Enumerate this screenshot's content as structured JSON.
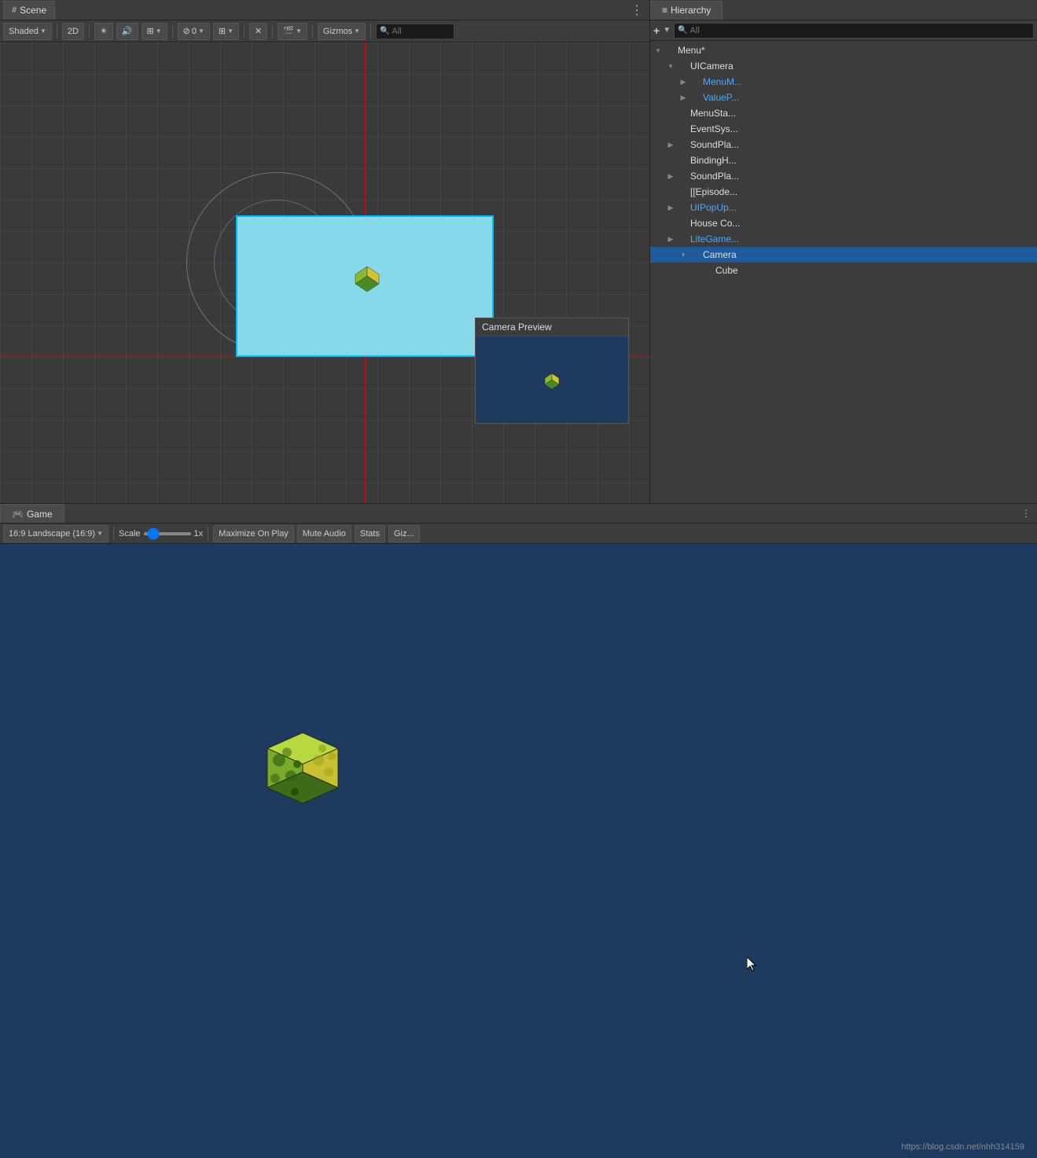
{
  "scene": {
    "tab_label": "Scene",
    "tab_icon": "#",
    "toolbar": {
      "shaded": "Shaded",
      "mode_2d": "2D",
      "persp_icon": "👁",
      "audio_icon": "🔊",
      "layer_icon": "⊞",
      "visibility": "⊘0",
      "grid_icon": "⊞",
      "tools_icon": "✕",
      "camera_icon": "🎬",
      "gizmos": "Gizmos",
      "search_placeholder": "All"
    },
    "options_icon": "⋮"
  },
  "camera_preview": {
    "title": "Camera Preview"
  },
  "hierarchy": {
    "tab_label": "Hierarchy",
    "tab_icon": "≡",
    "search_placeholder": "All",
    "items": [
      {
        "id": "menu",
        "label": "Menu*",
        "indent": 0,
        "arrow": "▾",
        "icon": "sphere",
        "selected": false,
        "blue": false
      },
      {
        "id": "uicamera",
        "label": "UICamera",
        "indent": 1,
        "arrow": "▾",
        "icon": "sphere",
        "selected": false,
        "blue": false
      },
      {
        "id": "menumain",
        "label": "MenuM...",
        "indent": 2,
        "arrow": "▶",
        "icon": "cube",
        "selected": false,
        "blue": true
      },
      {
        "id": "valuep",
        "label": "ValueP...",
        "indent": 2,
        "arrow": "▶",
        "icon": "cube",
        "selected": false,
        "blue": true
      },
      {
        "id": "menustage",
        "label": "MenuSta...",
        "indent": 1,
        "arrow": "",
        "icon": "sphere",
        "selected": false,
        "blue": false
      },
      {
        "id": "eventsys",
        "label": "EventSys...",
        "indent": 1,
        "arrow": "",
        "icon": "sphere",
        "selected": false,
        "blue": false
      },
      {
        "id": "soundpla1",
        "label": "SoundPla...",
        "indent": 1,
        "arrow": "▶",
        "icon": "sphere",
        "selected": false,
        "blue": false
      },
      {
        "id": "bindingh",
        "label": "BindingH...",
        "indent": 1,
        "arrow": "",
        "icon": "sphere",
        "selected": false,
        "blue": false
      },
      {
        "id": "soundpla2",
        "label": "SoundPla...",
        "indent": 1,
        "arrow": "▶",
        "icon": "sphere",
        "selected": false,
        "blue": false
      },
      {
        "id": "episode",
        "label": "[[Episode...",
        "indent": 1,
        "arrow": "",
        "icon": "sphere",
        "selected": false,
        "blue": false
      },
      {
        "id": "uipopup",
        "label": "UIPopUp...",
        "indent": 1,
        "arrow": "▶",
        "icon": "cube",
        "selected": false,
        "blue": true
      },
      {
        "id": "houseco",
        "label": "House Co...",
        "indent": 1,
        "arrow": "",
        "icon": "sphere",
        "selected": false,
        "blue": false
      },
      {
        "id": "litegame",
        "label": "LiteGame...",
        "indent": 1,
        "arrow": "▶",
        "icon": "cube",
        "selected": false,
        "blue": true
      },
      {
        "id": "camera",
        "label": "Camera",
        "indent": 2,
        "arrow": "▾",
        "icon": "camera",
        "selected": true,
        "blue": false
      },
      {
        "id": "cube",
        "label": "Cube",
        "indent": 3,
        "arrow": "",
        "icon": "sphere",
        "selected": false,
        "blue": false
      }
    ]
  },
  "game": {
    "tab_label": "Game",
    "tab_icon": "🎮",
    "options_icon": "⋮",
    "toolbar": {
      "resolution": "16:9 Landscape (16:9)",
      "scale_label": "Scale",
      "scale_value": "1x",
      "maximize": "Maximize On Play",
      "mute": "Mute Audio",
      "stats": "Stats",
      "gizmos": "Giz..."
    }
  },
  "footer": {
    "url": "https://blog.csdn.net/nhh314159"
  }
}
